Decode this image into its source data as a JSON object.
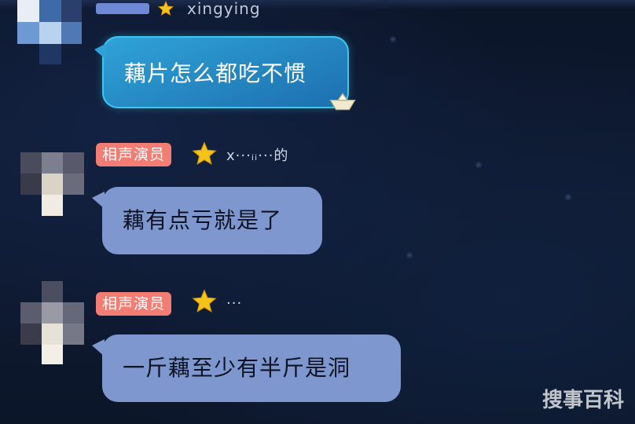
{
  "messages": [
    {
      "badge": "",
      "nickname": "xingying",
      "text": "藕片怎么都吃不惯"
    },
    {
      "badge": "相声演员",
      "nickname": "x···ᵢᵢ···的",
      "text": "藕有点亏就是了"
    },
    {
      "badge": "相声演员",
      "nickname": "···",
      "text": "一斤藕至少有半斤是洞"
    }
  ],
  "watermark": "搜事百科",
  "colors": {
    "background": "#0d1629",
    "badge": "#f47d73",
    "bubble_plain": "#7f97cf",
    "bubble_fancy": "#2fa3d7",
    "star": "#f6c21c"
  }
}
